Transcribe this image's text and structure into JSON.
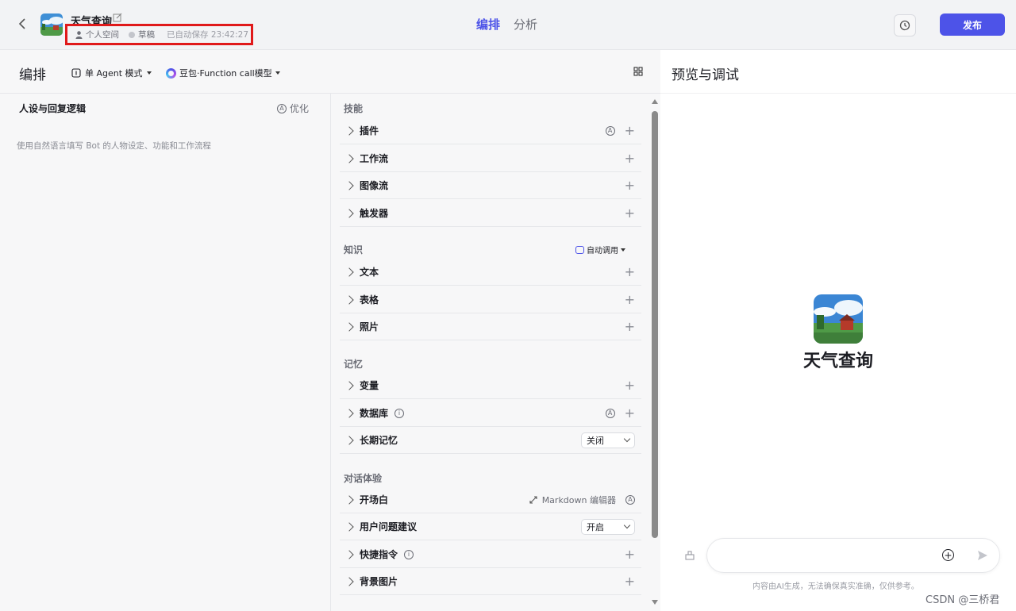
{
  "header": {
    "bot_name": "天气查询",
    "space": "个人空间",
    "status": "草稿",
    "autosave": "已自动保存 23:42:27",
    "tabs": [
      {
        "label": "编排",
        "active": true
      },
      {
        "label": "分析",
        "active": false
      }
    ],
    "publish_label": "发布"
  },
  "toolbar": {
    "title": "编排",
    "agent_mode": "单 Agent 模式",
    "model": "豆包·Function call模型"
  },
  "persona": {
    "title": "人设与回复逻辑",
    "optimize_label": "优化",
    "placeholder": "使用自然语言填写 Bot 的人物设定、功能和工作流程"
  },
  "sections": {
    "skills": {
      "label": "技能",
      "items": [
        "插件",
        "工作流",
        "图像流",
        "触发器"
      ]
    },
    "knowledge": {
      "label": "知识",
      "auto_call": "自动调用",
      "items": [
        "文本",
        "表格",
        "照片"
      ]
    },
    "memory": {
      "label": "记忆",
      "items": [
        "变量",
        "数据库",
        "长期记忆"
      ],
      "long_term_value": "关闭"
    },
    "dialog": {
      "label": "对话体验",
      "items": [
        "开场白",
        "用户问题建议",
        "快捷指令",
        "背景图片"
      ],
      "markdown_label": "Markdown 编辑器",
      "suggestion_value": "开启"
    }
  },
  "preview": {
    "title": "预览与调试",
    "bot_name": "天气查询",
    "input_placeholder": "",
    "disclaimer": "内容由AI生成，无法确保真实准确，仅供参考。"
  },
  "watermark": "CSDN @三桥君",
  "colors": {
    "accent": "#4d53e8",
    "highlight_box": "#e0191a"
  }
}
